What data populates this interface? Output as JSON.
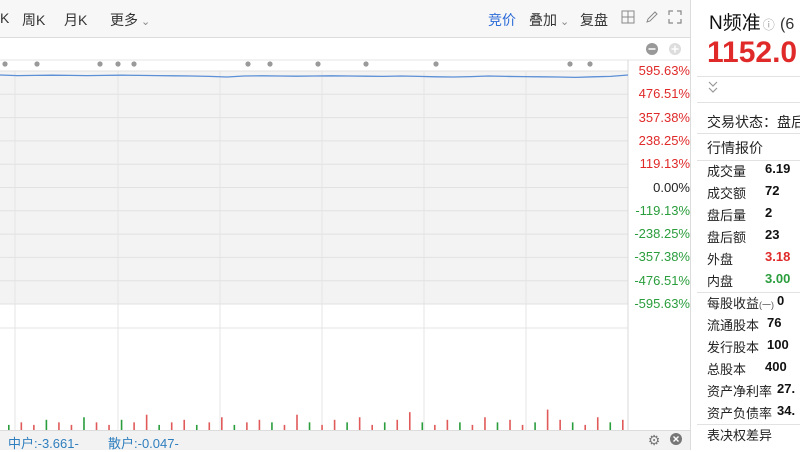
{
  "toolbar": {
    "items": [
      {
        "label": "K"
      },
      {
        "label": "周K"
      },
      {
        "label": "月K"
      },
      {
        "label": "更多"
      }
    ],
    "bidding": "竞价",
    "overlay": "叠加",
    "replay": "复盘",
    "icons": [
      "grid-icon",
      "pen-icon",
      "expand-icon"
    ]
  },
  "chart_data": {
    "type": "line",
    "y_tick_labels": [
      "595.63%",
      "476.51%",
      "357.38%",
      "238.25%",
      "119.13%",
      "0.00%",
      "-119.13%",
      "-238.25%",
      "-357.38%",
      "-476.51%",
      "-595.63%"
    ],
    "ylim": [
      -595.63,
      595.63
    ],
    "series": [
      {
        "values": [
          575,
          572,
          573,
          574,
          573,
          572,
          573,
          574,
          573,
          572,
          571,
          570,
          568,
          565,
          570,
          571,
          570,
          569,
          570,
          571,
          570,
          569,
          568,
          570,
          568,
          566,
          565,
          567,
          570,
          568,
          567,
          566,
          565,
          563,
          566,
          568,
          575
        ],
        "color": "#5b8fd6"
      }
    ],
    "volume": [
      2,
      3,
      2,
      4,
      3,
      2,
      5,
      3,
      2,
      4,
      3,
      6,
      2,
      3,
      4,
      2,
      3,
      5,
      2,
      3,
      4,
      3,
      2,
      6,
      3,
      2,
      4,
      3,
      5,
      2,
      3,
      4,
      7,
      3,
      2,
      4,
      3,
      2,
      5,
      3,
      4,
      2,
      3,
      8,
      4,
      3,
      2,
      5,
      3,
      4
    ]
  },
  "status_bar": {
    "mid_investor": "中户:-3.661-",
    "retail_investor": "散户:-0.047-"
  },
  "right_panel": {
    "name": "N频准",
    "code": "(6",
    "price": "1152.0",
    "trading_status_label": "交易状态：盘后",
    "section_title": "行情报价",
    "rows": [
      {
        "label": "成交量",
        "value": "6.19",
        "color": "#111111"
      },
      {
        "label": "成交额",
        "value": "72",
        "color": "#111111"
      },
      {
        "label": "盘后量",
        "value": "2",
        "color": "#111111"
      },
      {
        "label": "盘后额",
        "value": "23",
        "color": "#111111"
      },
      {
        "label": "外盘",
        "value": "3.18",
        "color": "#e02a2a"
      },
      {
        "label": "内盘",
        "value": "3.00",
        "color": "#2a9d3c"
      },
      {
        "label": "每股收益",
        "sub": "(一)",
        "value": "0",
        "color": "#111111"
      },
      {
        "label": "流通股本",
        "value": "76",
        "color": "#111111"
      },
      {
        "label": "发行股本",
        "value": "100",
        "color": "#111111"
      },
      {
        "label": "总股本",
        "value": "400",
        "color": "#111111"
      },
      {
        "label": "资产净利率",
        "value": "27.",
        "color": "#111111"
      },
      {
        "label": "资产负债率",
        "value": "34.",
        "color": "#111111"
      },
      {
        "label": "表决权差异",
        "value": "",
        "color": "#111111"
      }
    ]
  },
  "colors": {
    "accent_blue": "#2a6ad7",
    "up_red": "#e02a2a",
    "down_green": "#2a9d3c"
  }
}
